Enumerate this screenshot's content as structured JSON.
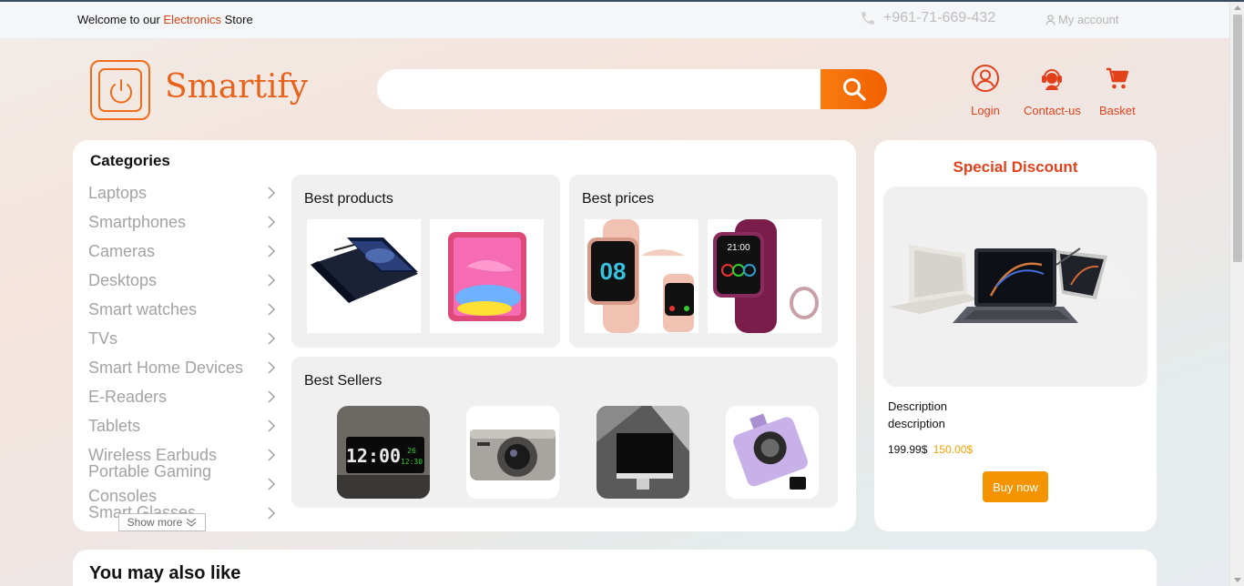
{
  "topbar": {
    "welcome_prefix": "Welcome to our",
    "welcome_accent": "Electronics",
    "welcome_suffix": "Store",
    "phone": "+961-71-669-432",
    "account": "My account"
  },
  "header": {
    "brand": "Smartify",
    "search_placeholder": "",
    "nav": [
      {
        "label": "Login",
        "icon": "user-icon"
      },
      {
        "label": "Contact-us",
        "icon": "support-agent-icon"
      },
      {
        "label": "Basket",
        "icon": "cart-icon"
      }
    ]
  },
  "categories": {
    "title": "Categories",
    "items": [
      "Laptops",
      "Smartphones",
      "Cameras",
      "Desktops",
      "Smart watches",
      "TVs",
      "Smart Home Devices",
      "E-Readers",
      "Tablets",
      "Wireless Earbuds",
      "Portable Gaming",
      "Consoles",
      "Smart Glasses"
    ],
    "show_more": "Show more"
  },
  "panels": {
    "best_products": {
      "title": "Best products",
      "images": [
        "laptop-image",
        "tablet-image"
      ]
    },
    "best_prices": {
      "title": "Best prices",
      "images": [
        "pink-smartwatch-image",
        "purple-smartwatch-image"
      ]
    },
    "best_sellers": {
      "title": "Best Sellers",
      "images": [
        "digital-clock-image",
        "compact-camera-image",
        "monitor-image",
        "purple-camera-image"
      ]
    }
  },
  "special_discount": {
    "title": "Special Discount",
    "description": "Description description",
    "old_price": "199.99$",
    "new_price": "150.00$",
    "buy_label": "Buy now"
  },
  "recommendations": {
    "title": "You may also like"
  },
  "colors": {
    "accent": "#e2421b",
    "orange": "#f49400",
    "brand": "#e8641c"
  }
}
